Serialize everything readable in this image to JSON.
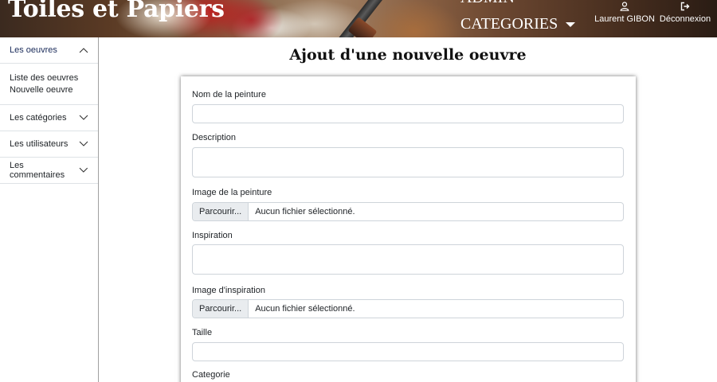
{
  "header": {
    "brand": "Toiles et Papiers",
    "nav_admin": "ADMIN",
    "nav_categories": "CATEGORIES",
    "user_name": "Laurent GIBON",
    "logout_label": "Déconnexion",
    "icons": {
      "user": "user-icon",
      "logout": "logout-icon",
      "dropdown": "caret-down-icon"
    }
  },
  "sidebar": {
    "items": [
      {
        "label": "Les oeuvres",
        "expanded": true,
        "children": [
          "Liste des oeuvres",
          "Nouvelle oeuvre"
        ]
      },
      {
        "label": "Les catégories",
        "expanded": false
      },
      {
        "label": "Les utilisateurs",
        "expanded": false
      },
      {
        "label": "Les commentaires",
        "expanded": false
      }
    ]
  },
  "main": {
    "title": "Ajout d'une nouvelle oeuvre",
    "form": {
      "nom_label": "Nom de la peinture",
      "nom_value": "",
      "description_label": "Description",
      "description_value": "",
      "image_label": "Image de la peinture",
      "image_button": "Parcourir...",
      "image_status": "Aucun fichier sélectionné.",
      "inspiration_label": "Inspiration",
      "inspiration_value": "",
      "image_inspiration_label": "Image d'inspiration",
      "image_inspiration_button": "Parcourir...",
      "image_inspiration_status": "Aucun fichier sélectionné.",
      "taille_label": "Taille",
      "taille_value": "",
      "categorie_label": "Categorie"
    }
  },
  "colors": {
    "sidebar_active": "#1a2b5a",
    "border": "#ced4da",
    "file_button_bg": "#e9ecef"
  }
}
